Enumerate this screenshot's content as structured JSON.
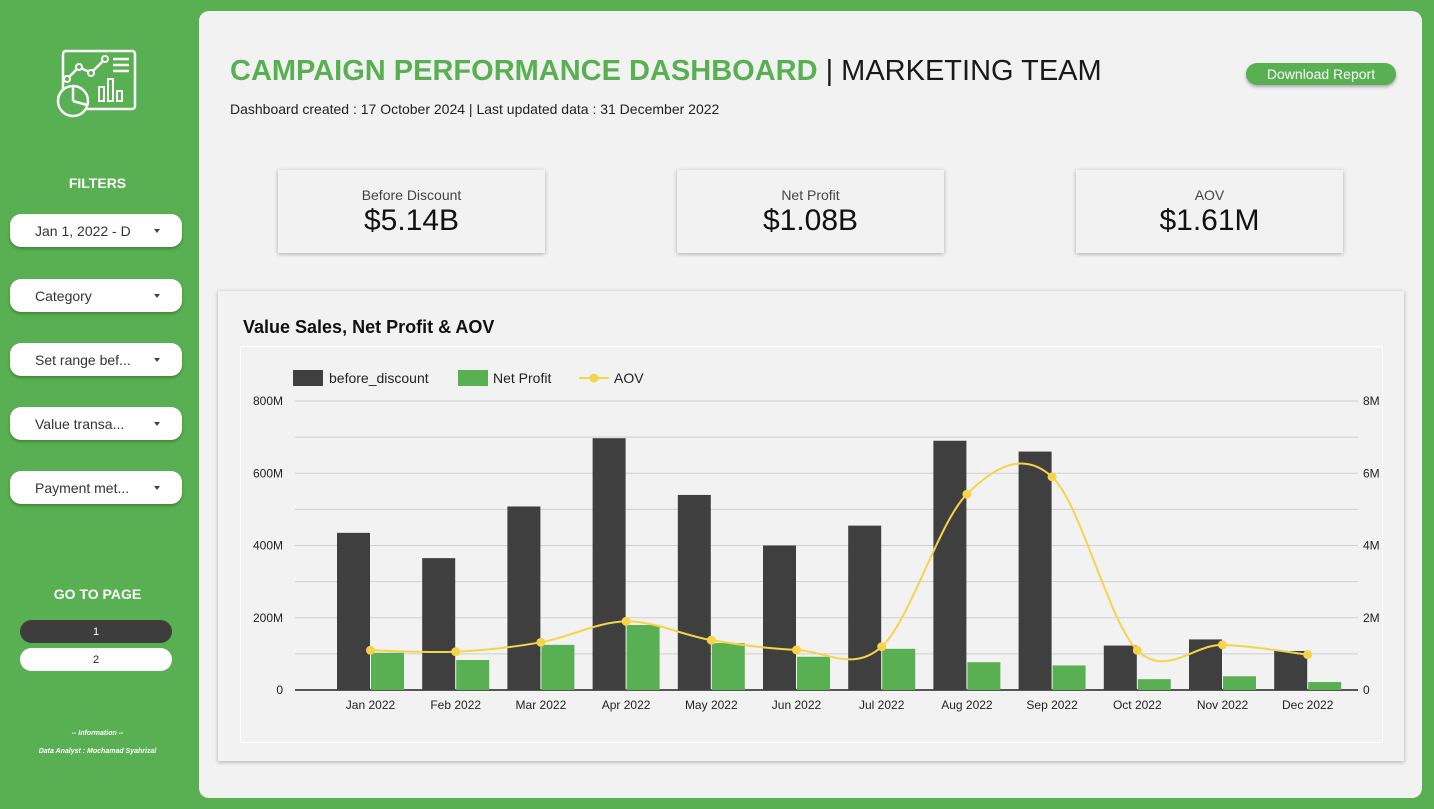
{
  "sidebar": {
    "logo_icon": "dashboard-analytics-icon",
    "filters_title": "FILTERS",
    "filters": [
      {
        "label": "Jan 1, 2022 - D",
        "icon": "caret-down-icon"
      },
      {
        "label": "Category",
        "icon": "caret-down-icon"
      },
      {
        "label": "Set range bef...",
        "icon": "caret-down-icon"
      },
      {
        "label": "Value transa...",
        "icon": "caret-down-icon"
      },
      {
        "label": "Payment met...",
        "icon": "caret-down-icon"
      }
    ],
    "goto_title": "GO TO PAGE",
    "pages": [
      "1",
      "2"
    ],
    "active_page": "1",
    "info_title": "-- Information --",
    "info_line": "Data Analyst : Mochamad Syahrizal"
  },
  "header": {
    "title_part1": "CAMPAIGN PERFORMANCE DASHBOARD",
    "title_part2": " | MARKETING TEAM",
    "subtitle": "Dashboard created : 17 October 2024 | Last updated data : 31 December 2022",
    "download_label": "Download Report"
  },
  "kpis": [
    {
      "label": "Before Discount",
      "value": "$5.14B"
    },
    {
      "label": "Net Profit",
      "value": "$1.08B"
    },
    {
      "label": "AOV",
      "value": "$1.61M"
    }
  ],
  "colors": {
    "brand_green": "#59b052",
    "bar_dark": "#3f3f3f",
    "aov_line": "#f5d44b",
    "panel_bg": "#f3f2f3"
  },
  "chart_data": {
    "type": "bar",
    "title": "Value Sales, Net Profit & AOV",
    "categories": [
      "Jan 2022",
      "Feb 2022",
      "Mar 2022",
      "Apr 2022",
      "May 2022",
      "Jun 2022",
      "Jul 2022",
      "Aug 2022",
      "Sep 2022",
      "Oct 2022",
      "Nov 2022",
      "Dec 2022"
    ],
    "series": [
      {
        "name": "before_discount",
        "type": "bar",
        "axis": "left",
        "values": [
          435,
          365,
          508,
          697,
          540,
          400,
          455,
          690,
          660,
          123,
          140,
          108
        ]
      },
      {
        "name": "Net Profit",
        "type": "bar",
        "axis": "left",
        "values": [
          103,
          83,
          125,
          180,
          130,
          92,
          114,
          77,
          68,
          30,
          38,
          22
        ]
      },
      {
        "name": "AOV",
        "type": "line",
        "axis": "right",
        "values": [
          1.1,
          1.06,
          1.32,
          1.9,
          1.38,
          1.11,
          1.2,
          5.42,
          5.9,
          1.1,
          1.25,
          0.98
        ]
      }
    ],
    "yleft_ticks": [
      "0",
      "200M",
      "400M",
      "600M",
      "800M"
    ],
    "yright_ticks": [
      "0",
      "2M",
      "4M",
      "6M",
      "8M"
    ],
    "yleft_lim": [
      0,
      800
    ],
    "yright_lim": [
      0,
      8
    ],
    "legend_position": "top-left",
    "grid": true
  }
}
